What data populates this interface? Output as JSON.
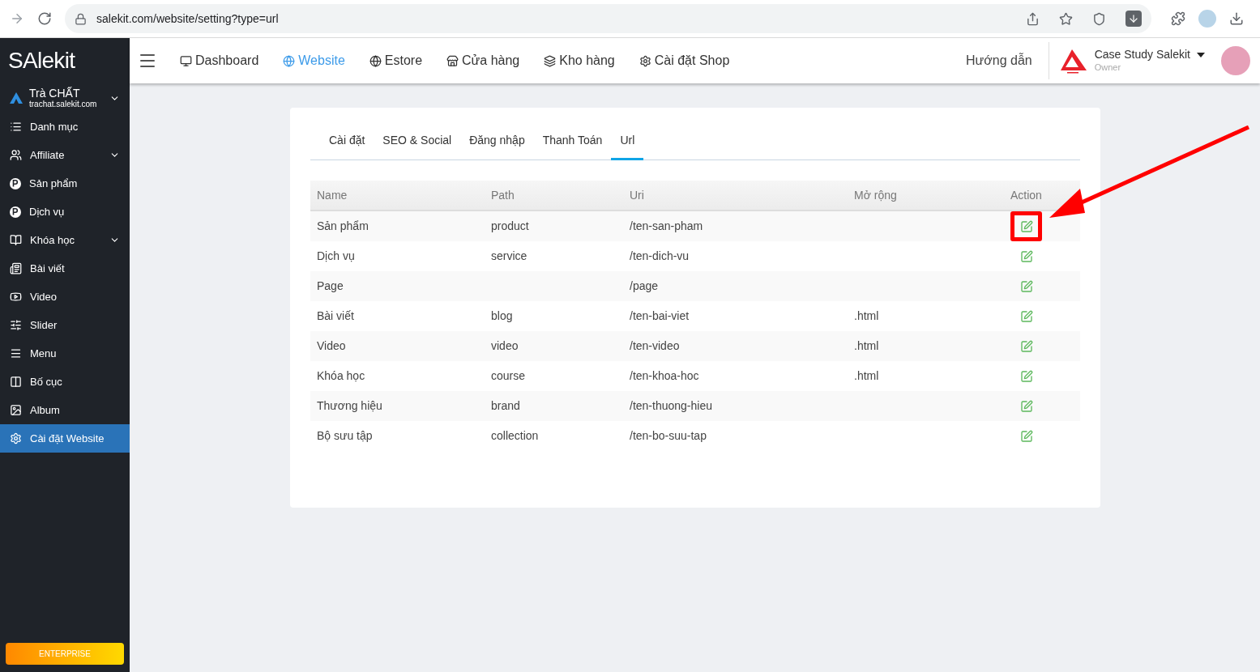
{
  "browser": {
    "url": "salekit.com/website/setting?type=url"
  },
  "sidebar": {
    "logo": "SAlekit",
    "account": {
      "name": "Trà CHẤT",
      "domain": "trachat.salekit.com"
    },
    "items": [
      {
        "label": "Danh mục",
        "expandable": false,
        "selected": false
      },
      {
        "label": "Affiliate",
        "expandable": true,
        "selected": false
      },
      {
        "label": "Sản phẩm",
        "expandable": false,
        "selected": false
      },
      {
        "label": "Dịch vụ",
        "expandable": false,
        "selected": false
      },
      {
        "label": "Khóa học",
        "expandable": true,
        "selected": false
      },
      {
        "label": "Bài viết",
        "expandable": false,
        "selected": false
      },
      {
        "label": "Video",
        "expandable": false,
        "selected": false
      },
      {
        "label": "Slider",
        "expandable": false,
        "selected": false
      },
      {
        "label": "Menu",
        "expandable": false,
        "selected": false
      },
      {
        "label": "Bố cục",
        "expandable": false,
        "selected": false
      },
      {
        "label": "Album",
        "expandable": false,
        "selected": false
      },
      {
        "label": "Cài đặt Website",
        "expandable": false,
        "selected": true
      }
    ],
    "plan_button": "ENTERPRISE"
  },
  "topnav": {
    "items": [
      {
        "label": "Dashboard",
        "selected": false
      },
      {
        "label": "Website",
        "selected": true
      },
      {
        "label": "Estore",
        "selected": false
      },
      {
        "label": "Cửa hàng",
        "selected": false
      },
      {
        "label": "Kho hàng",
        "selected": false
      },
      {
        "label": "Cài đặt Shop",
        "selected": false
      }
    ],
    "help": "Hướng dẫn",
    "shop": {
      "name": "Case Study Salekit",
      "role": "Owner"
    }
  },
  "tabs": [
    {
      "label": "Cài đặt",
      "selected": false
    },
    {
      "label": "SEO & Social",
      "selected": false
    },
    {
      "label": "Đăng nhập",
      "selected": false
    },
    {
      "label": "Thanh Toán",
      "selected": false
    },
    {
      "label": "Url",
      "selected": true
    }
  ],
  "table": {
    "columns": [
      "Name",
      "Path",
      "Uri",
      "Mở rộng",
      "Action"
    ],
    "rows": [
      {
        "name": "Sản phẩm",
        "path": "product",
        "uri": "/ten-san-pham",
        "extension": "",
        "highlighted": true
      },
      {
        "name": "Dịch vụ",
        "path": "service",
        "uri": "/ten-dich-vu",
        "extension": "",
        "highlighted": false
      },
      {
        "name": "Page",
        "path": "",
        "uri": "/page",
        "extension": "",
        "highlighted": false
      },
      {
        "name": "Bài viết",
        "path": "blog",
        "uri": "/ten-bai-viet",
        "extension": ".html",
        "highlighted": false
      },
      {
        "name": "Video",
        "path": "video",
        "uri": "/ten-video",
        "extension": ".html",
        "highlighted": false
      },
      {
        "name": "Khóa học",
        "path": "course",
        "uri": "/ten-khoa-hoc",
        "extension": ".html",
        "highlighted": false
      },
      {
        "name": "Thương hiệu",
        "path": "brand",
        "uri": "/ten-thuong-hieu",
        "extension": "",
        "highlighted": false
      },
      {
        "name": "Bộ sưu tập",
        "path": "collection",
        "uri": "/ten-bo-suu-tap",
        "extension": "",
        "highlighted": false
      }
    ]
  }
}
